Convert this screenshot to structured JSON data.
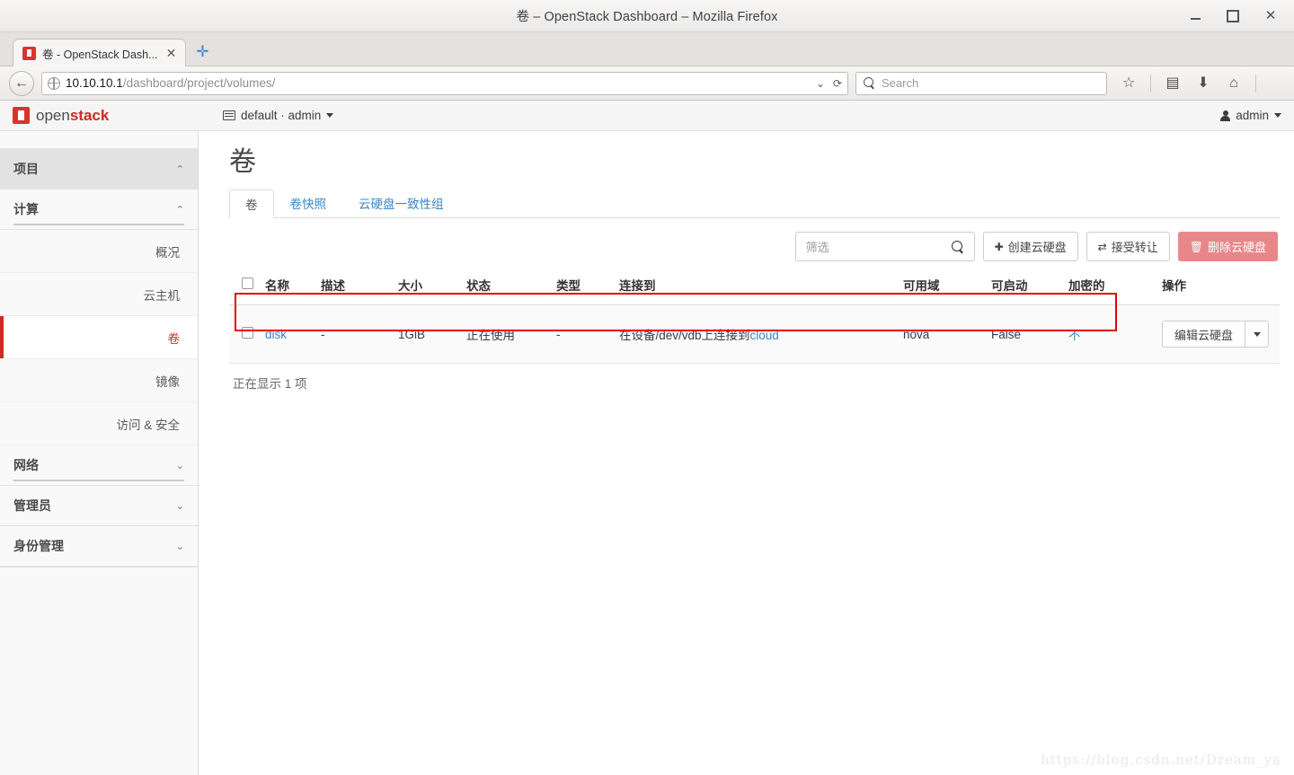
{
  "browser": {
    "window_title": "卷 – OpenStack Dashboard – Mozilla Firefox",
    "minimize_label": "–",
    "maximize_label": "□",
    "close_label": "✕",
    "tab": {
      "title": "卷 - OpenStack Dash...",
      "close_label": "✕",
      "favicon": "openstack-favicon"
    },
    "new_tab_label": "✛",
    "back_label": "←",
    "url_host": "10.10.10.1",
    "url_path": "/dashboard/project/volumes/",
    "url_dropdown_label": "⌄",
    "reload_label": "⟳",
    "search_placeholder": "Search",
    "icons": {
      "bookmark": "☆",
      "reading_list": "▤",
      "downloads": "⬇",
      "home": "⌂",
      "menu": "hamburger-icon"
    }
  },
  "dashboard": {
    "logo_text_light": "open",
    "logo_text_bold": "stack",
    "context_switcher": "default · admin",
    "user_menu": "admin"
  },
  "sidebar": {
    "groups": [
      {
        "label": "项目",
        "chevron": "⌃",
        "active": true
      },
      {
        "label": "计算",
        "chevron": "⌃",
        "active": false
      }
    ],
    "compute_items": [
      {
        "label": "概况",
        "active": false
      },
      {
        "label": "云主机",
        "active": false
      },
      {
        "label": "卷",
        "active": true
      },
      {
        "label": "镜像",
        "active": false
      },
      {
        "label": "访问 & 安全",
        "active": false
      }
    ],
    "bottom_groups": [
      {
        "label": "网络",
        "chevron": "⌄"
      },
      {
        "label": "管理员",
        "chevron": "⌄"
      },
      {
        "label": "身份管理",
        "chevron": "⌄"
      }
    ]
  },
  "main": {
    "page_title": "卷",
    "tabs": [
      {
        "label": "卷",
        "active": true
      },
      {
        "label": "卷快照",
        "active": false
      },
      {
        "label": "云硬盘一致性组",
        "active": false
      }
    ],
    "toolbar": {
      "filter_placeholder": "筛选",
      "create_label": "创建云硬盘",
      "create_icon": "✚",
      "accept_transfer_label": "接受转让",
      "accept_transfer_icon": "⇄",
      "delete_label": "删除云硬盘",
      "delete_icon": "🗑"
    },
    "table": {
      "headers": [
        "名称",
        "描述",
        "大小",
        "状态",
        "类型",
        "连接到",
        "可用域",
        "可启动",
        "加密的",
        "操作"
      ],
      "rows": [
        {
          "name": "disk",
          "description": "-",
          "size": "1GiB",
          "status": "正在使用",
          "type": "-",
          "attached_prefix": "在设备/dev/vdb上连接到",
          "attached_link": "cloud",
          "availability_zone": "nova",
          "bootable": "False",
          "encrypted": "不",
          "action_label": "编辑云硬盘",
          "action_caret": "▾"
        }
      ],
      "footer": "正在显示 1 项"
    }
  },
  "watermark": "https://blog.csdn.net/Dream_ya",
  "colors": {
    "brand_red": "#cc2b21",
    "link_blue": "#3a87c8",
    "danger_btn": "#e8878a",
    "annotation_red": "#e60000"
  }
}
